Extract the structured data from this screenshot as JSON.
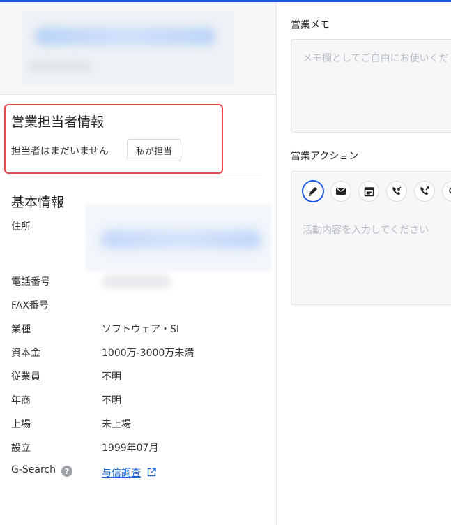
{
  "colors": {
    "accent": "#1a56e8",
    "highlight_border": "#e5484d",
    "link": "#1a66d8"
  },
  "sales_rep": {
    "title": "営業担当者情報",
    "none_text": "担当者はまだいません",
    "assign_button": "私が担当"
  },
  "basic_info": {
    "title": "基本情報",
    "rows": [
      {
        "label": "住所",
        "value": ""
      },
      {
        "label": "電話番号",
        "value": ""
      },
      {
        "label": "FAX番号",
        "value": ""
      },
      {
        "label": "業種",
        "value": "ソフトウェア・SI"
      },
      {
        "label": "資本金",
        "value": "1000万-3000万未満"
      },
      {
        "label": "従業員",
        "value": "不明"
      },
      {
        "label": "年商",
        "value": "不明"
      },
      {
        "label": "上場",
        "value": "未上場"
      },
      {
        "label": "設立",
        "value": "1999年07月"
      }
    ],
    "gsearch_label": "G-Search",
    "gsearch_help_icon": "question-circle-icon",
    "gsearch_link": "与信調査",
    "gsearch_link_icon": "external-link-icon"
  },
  "memo": {
    "label": "営業メモ",
    "placeholder": "メモ欄としてご自由にお使いくだ"
  },
  "actions": {
    "label": "営業アクション",
    "tools": [
      "pencil-icon",
      "mail-icon",
      "calendar-icon",
      "incoming-call-icon",
      "outgoing-call-icon",
      "visit-icon"
    ],
    "placeholder": "活動内容を入力してください"
  }
}
